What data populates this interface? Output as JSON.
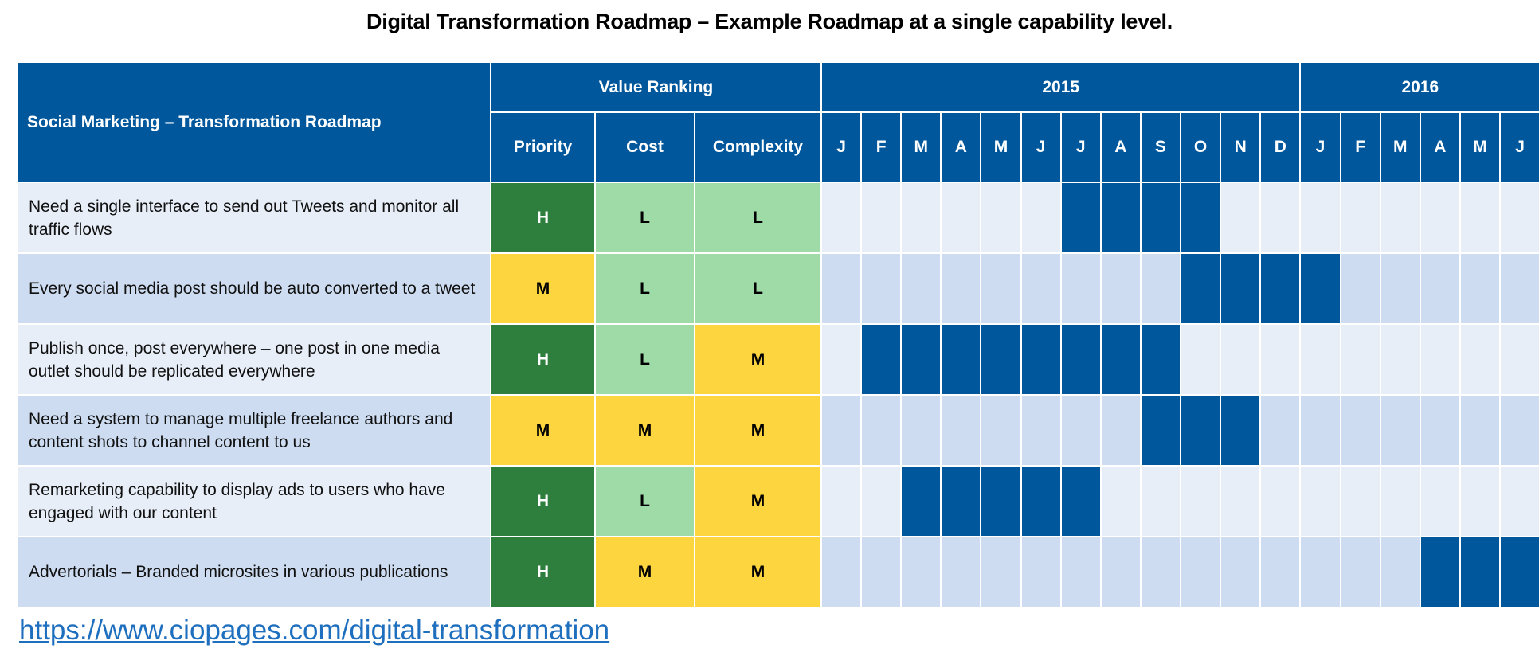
{
  "title": "Digital Transformation Roadmap – Example Roadmap at a single capability level.",
  "table": {
    "main_header": "Social Marketing  – Transformation Roadmap",
    "value_ranking_header": "Value Ranking",
    "value_columns": [
      "Priority",
      "Cost",
      "Complexity"
    ],
    "years": [
      {
        "label": "2015",
        "months": 12
      },
      {
        "label": "2016",
        "months": 6
      }
    ],
    "months": [
      "J",
      "F",
      "M",
      "A",
      "M",
      "J",
      "J",
      "A",
      "S",
      "O",
      "N",
      "D",
      "J",
      "F",
      "M",
      "A",
      "M",
      "J"
    ]
  },
  "rating_colors": {
    "H": {
      "bg": "#2e7f3e",
      "fg": "#ffffff"
    },
    "M": {
      "bg": "#fdd63f",
      "fg": "#000000"
    },
    "L": {
      "bg": "#9fdba6",
      "fg": "#000000"
    }
  },
  "colors": {
    "header_bg": "#01579b",
    "active_month": "#01579b",
    "row_light": "#e7eef8",
    "row_dark": "#cddcf0"
  },
  "rows": [
    {
      "requirement": "Need a single interface to send out Tweets and monitor all traffic flows",
      "priority": "H",
      "cost": "L",
      "complexity": "L",
      "active_months": [
        6,
        7,
        8,
        9
      ]
    },
    {
      "requirement": "Every social media post should be auto converted to a tweet",
      "priority": "M",
      "cost": "L",
      "complexity": "L",
      "active_months": [
        9,
        10,
        11,
        12
      ]
    },
    {
      "requirement": "Publish once, post everywhere – one post in one media outlet should be replicated everywhere",
      "priority": "H",
      "cost": "L",
      "complexity": "M",
      "active_months": [
        1,
        2,
        3,
        4,
        5,
        6,
        7,
        8
      ]
    },
    {
      "requirement": "Need a system to manage multiple freelance authors and content shots to channel content to us",
      "priority": "M",
      "cost": "M",
      "complexity": "M",
      "active_months": [
        8,
        9,
        10
      ]
    },
    {
      "requirement": "Remarketing capability to display ads to users who have engaged with our content",
      "priority": "H",
      "cost": "L",
      "complexity": "M",
      "active_months": [
        2,
        3,
        4,
        5,
        6
      ]
    },
    {
      "requirement": "Advertorials – Branded microsites in various publications",
      "priority": "H",
      "cost": "M",
      "complexity": "M",
      "active_months": [
        15,
        16,
        17
      ]
    }
  ],
  "footer_link": "https://www.ciopages.com/digital-transformation"
}
